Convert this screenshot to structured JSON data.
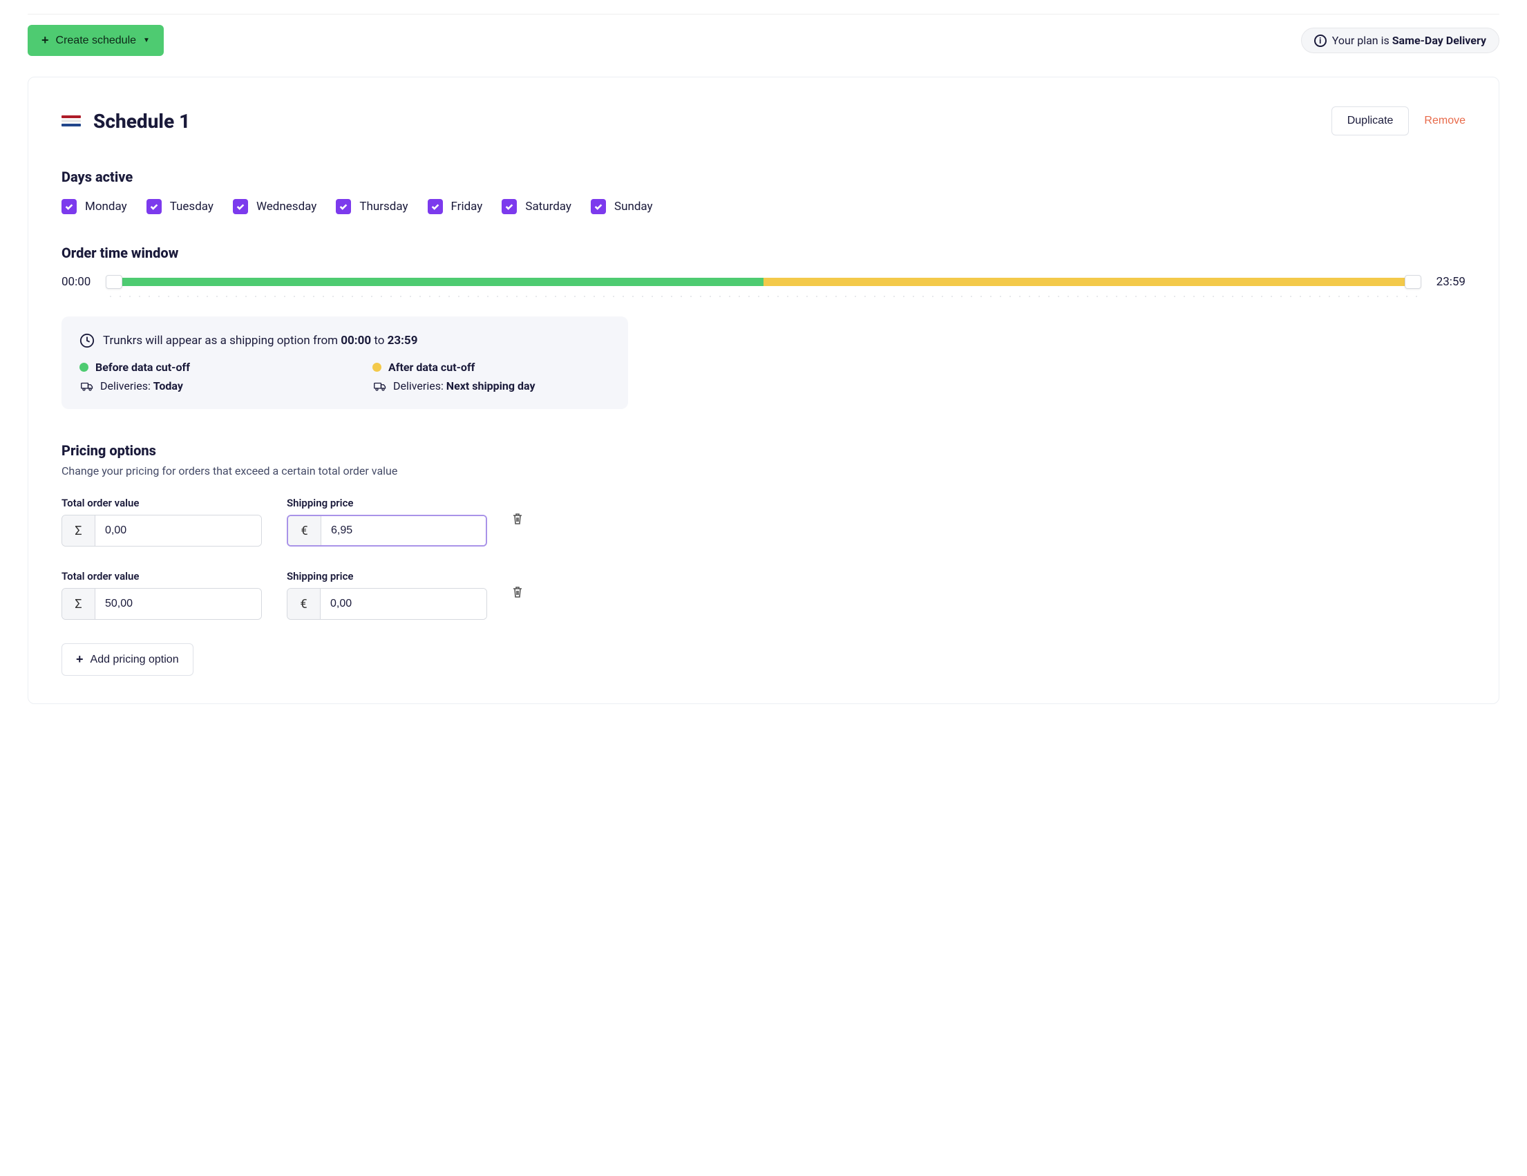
{
  "topbar": {
    "create_label": "Create schedule",
    "plan_prefix": "Your plan is ",
    "plan_name": "Same-Day Delivery"
  },
  "schedule": {
    "title": "Schedule 1",
    "duplicate_label": "Duplicate",
    "remove_label": "Remove",
    "days_heading": "Days active",
    "days": [
      "Monday",
      "Tuesday",
      "Wednesday",
      "Thursday",
      "Friday",
      "Saturday",
      "Sunday"
    ],
    "window_heading": "Order time window",
    "window_start": "00:00",
    "window_end": "23:59",
    "info": {
      "line_prefix": "Trunkrs will appear as a shipping option from ",
      "line_mid": " to ",
      "from": "00:00",
      "to": "23:59",
      "before_label": "Before data cut-off",
      "after_label": "After data cut-off",
      "deliveries_label": "Deliveries: ",
      "before_value": "Today",
      "after_value": "Next shipping day"
    },
    "pricing": {
      "heading": "Pricing options",
      "sub": "Change your pricing for orders that exceed a certain total order value",
      "col1_label": "Total order value",
      "col2_label": "Shipping price",
      "rows": [
        {
          "total": "0,00",
          "price": "6,95",
          "price_focused": true
        },
        {
          "total": "50,00",
          "price": "0,00",
          "price_focused": false
        }
      ],
      "add_label": "Add pricing option"
    }
  }
}
